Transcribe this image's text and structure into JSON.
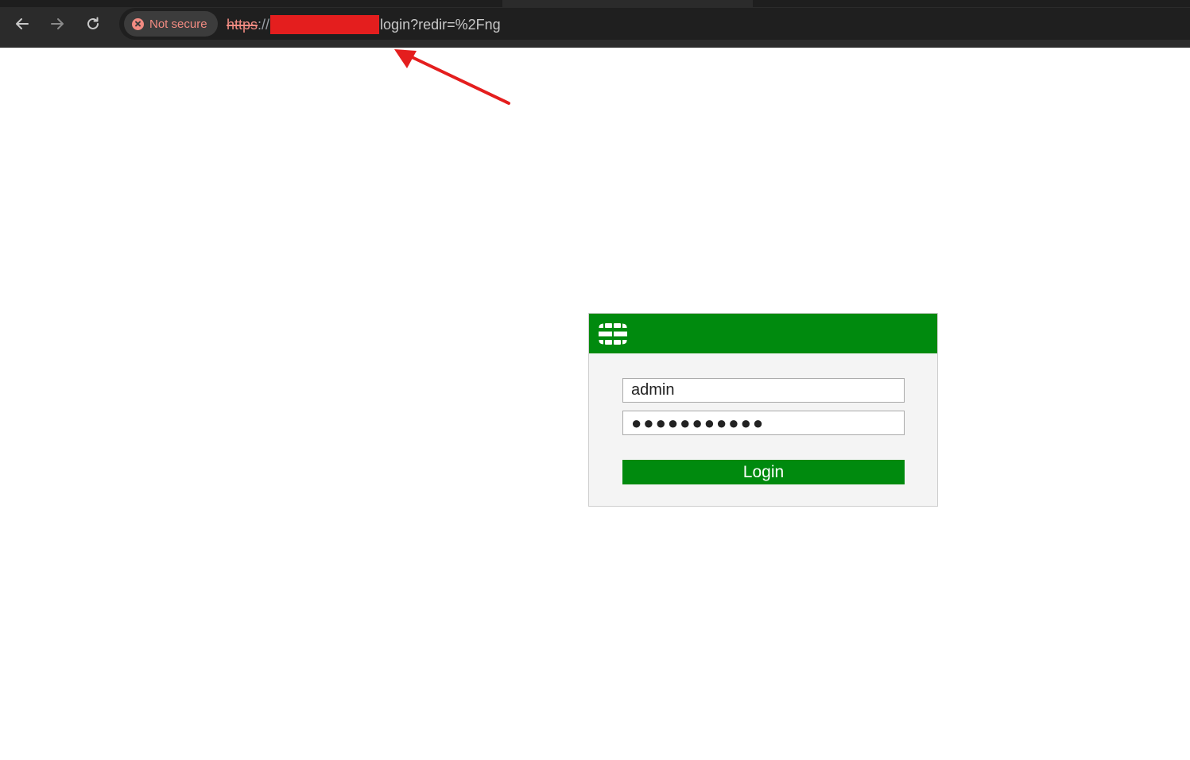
{
  "browser": {
    "nav": {
      "back_icon": "arrow-left-icon",
      "forward_icon": "arrow-right-icon",
      "reload_icon": "reload-icon"
    },
    "security_chip": {
      "label": "Not secure",
      "icon": "warning-circle-x-icon",
      "color": "#f28b82"
    },
    "url": {
      "scheme": "https",
      "separator": "://",
      "redacted": true,
      "path": "login?redir=%2Fng"
    }
  },
  "annotation": {
    "type": "red-arrow",
    "color": "#e41e1e",
    "points_to": "url"
  },
  "login": {
    "header_color": "#008a0e",
    "logo_icon": "fortinet-logo-icon",
    "username": "admin",
    "password_mask": "●●●●●●●●●●●",
    "button_label": "Login",
    "button_color": "#008a0e"
  }
}
